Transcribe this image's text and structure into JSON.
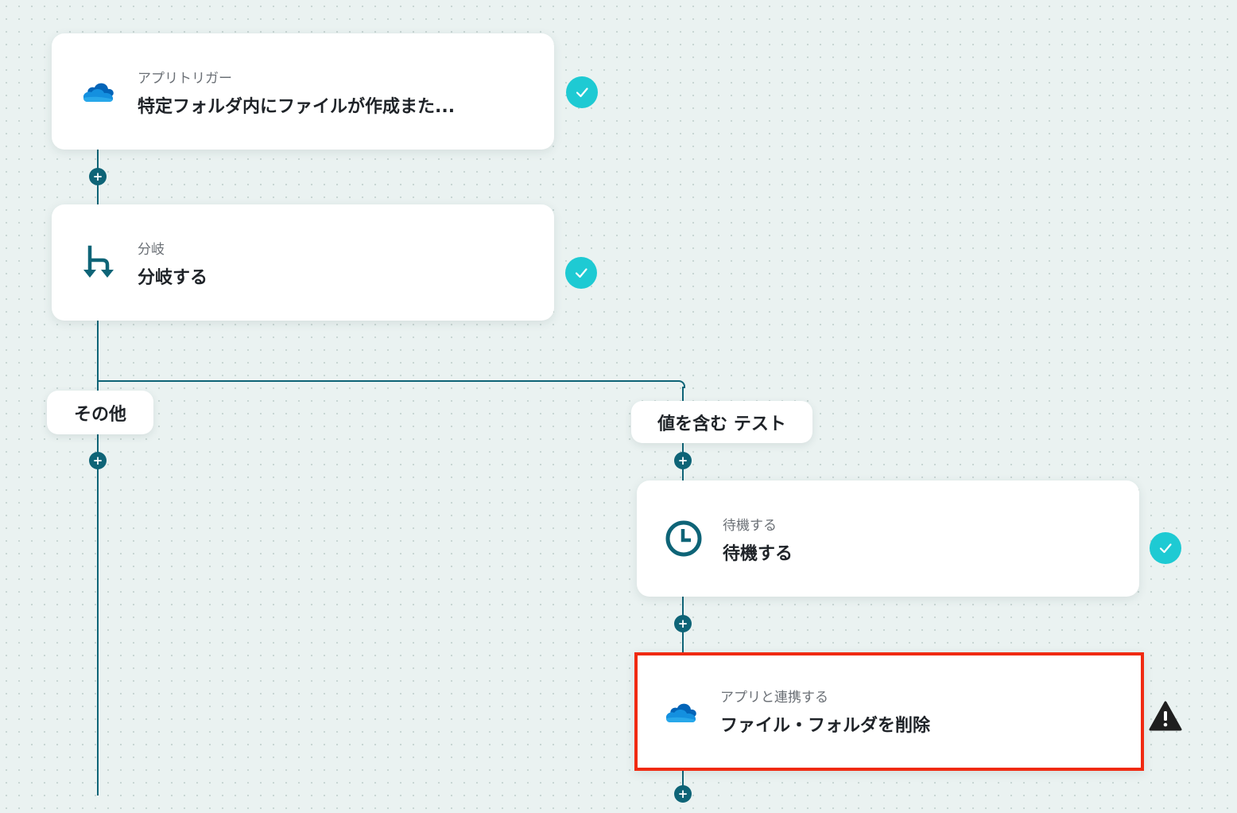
{
  "steps": [
    {
      "subtitle": "アプリトリガー",
      "title": "特定フォルダ内にファイルが作成また...",
      "icon": "onedrive-icon",
      "status": "check-icon"
    },
    {
      "subtitle": "分岐",
      "title": "分岐する",
      "icon": "branch-icon",
      "status": "check-icon"
    },
    {
      "subtitle": "待機する",
      "title": "待機する",
      "icon": "clock-icon",
      "status": "check-icon"
    },
    {
      "subtitle": "アプリと連携する",
      "title": "ファイル・フォルダを削除",
      "icon": "onedrive-icon",
      "status": "warning-icon"
    }
  ],
  "branches": {
    "other": "その他",
    "contains": "値を含む テスト"
  },
  "add_step_symbol": "+",
  "colors": {
    "canvas": "#eaf2f1",
    "connector": "#0e6477",
    "check": "#1ecad3",
    "selected_border": "#f02a11",
    "warning": "#1f1f1f"
  }
}
